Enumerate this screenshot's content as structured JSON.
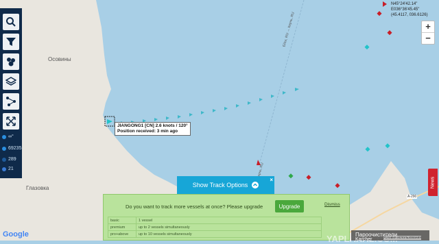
{
  "map": {
    "place_labels": [
      "Осовины",
      "Глазовка"
    ],
    "shipping_lane_labels": [
      "Ейск, RU → Керчь, RU",
      "Керчь, RU"
    ],
    "road_label": "А-290",
    "coordinates": {
      "lat": "N45°24'42.14\"",
      "lon": "E036°36'45.45\"",
      "decimal": "(45.4117, 036.6126)"
    },
    "copyright": "Условия использования"
  },
  "sidebar": {
    "buttons": [
      "search-icon",
      "filter-icon",
      "vessels-icon",
      "layers-icon",
      "network-icon",
      "fullscreen-icon"
    ],
    "stats": [
      {
        "value": "∞°",
        "color": "#2a8ee0"
      },
      {
        "value": "69235",
        "color": "#2a8ee0"
      },
      {
        "value": "289",
        "color": "#1e5a9a"
      },
      {
        "value": "21",
        "color": "#3a7bd5"
      }
    ]
  },
  "zoom": {
    "in": "+",
    "out": "−"
  },
  "vessel_tooltip": {
    "name_line": "JIANGONG1 [CN] 2.6 knots / 120°",
    "position_line": "Position received: 3 min ago"
  },
  "track_bar": {
    "label": "Show Track Options",
    "close": "×"
  },
  "upsell": {
    "question": "Do you want to track more vessels at once? Please upgrade",
    "upgrade_label": "Upgrade",
    "dismiss_label": "Dismiss",
    "plans": [
      {
        "plan": "basic",
        "desc": "1 vessel"
      },
      {
        "plan": "premium",
        "desc": "up to 2 vessels simultaneously"
      },
      {
        "plan": "pro+above",
        "desc": "up to 10 vessels simultaneously"
      }
    ]
  },
  "ad": {
    "line1": "Пароочистители",
    "line2": "Karcher",
    "watermark": "YAPLAKAL.COM"
  },
  "news_tab": "News",
  "google_logo": "Google",
  "colors": {
    "sea": "#a8cfe6",
    "land": "#e9e6df",
    "sidebar": "#0f2a4a",
    "track": "#3fb8c9",
    "vessel_red": "#c81e28",
    "vessel_green": "#2fa84a",
    "vessel_cyan": "#22c3c9"
  }
}
